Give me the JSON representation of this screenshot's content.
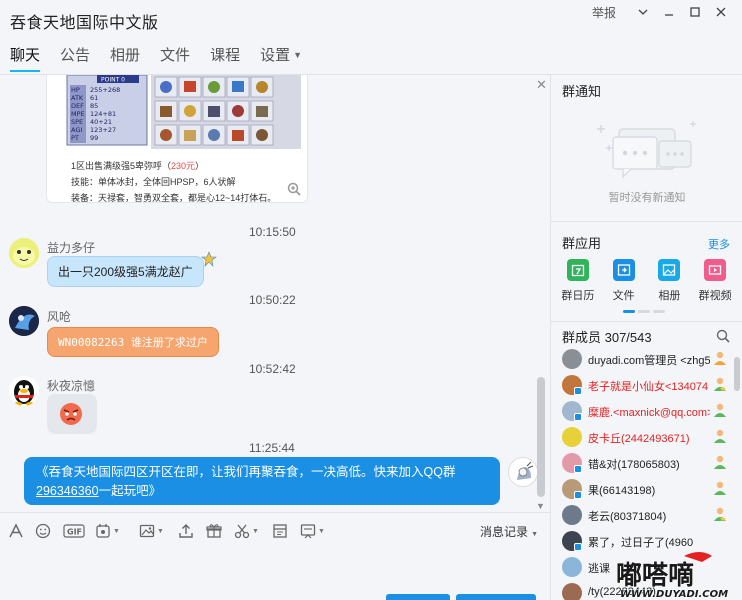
{
  "window": {
    "title": "吞食天地国际中文版",
    "report_label": "举报"
  },
  "tabs": [
    {
      "label": "聊天",
      "active": true
    },
    {
      "label": "公告"
    },
    {
      "label": "相册"
    },
    {
      "label": "文件"
    },
    {
      "label": "课程"
    },
    {
      "label": "设置"
    }
  ],
  "chat": {
    "card": {
      "stat_title": "POINT 0",
      "stats": [
        "255+268",
        "61",
        "85",
        "124+81",
        "40+21",
        "123+27",
        "99"
      ],
      "stat_labels": [
        "HP",
        "ATK",
        "DEF",
        "MPE",
        "SPE",
        "AGI",
        "PT"
      ],
      "line1": "1区出售满级强5卑弥呼（",
      "price": "230元",
      "line1_end": "）",
      "line2": "技能：单体冰封，全体回HPSP，6人状解",
      "line3": "装备：天禄套，智勇双全套，都是心12~14打体石。"
    },
    "messages": [
      {
        "time": "10:15:50",
        "nick": "益力多仔",
        "text": "出一只200级强5满龙赵广",
        "style": "blue"
      },
      {
        "time": "10:50:22",
        "nick": "风呛",
        "text": "WN00082263 谁注册了求过户",
        "style": "orange"
      },
      {
        "time": "10:52:42",
        "nick": "秋夜凉憶",
        "text": "",
        "style": "sticker"
      },
      {
        "time": "11:25:44",
        "self": true,
        "text_before": "《吞食天地国际四区开区在即，让我们再聚吞食，一决高低。快来加入QQ群",
        "group_number": "296346360",
        "text_after": "一起玩吧》"
      }
    ]
  },
  "toolbar": {
    "history_label": "消息记录"
  },
  "right": {
    "notice_title": "群通知",
    "notice_empty": "暂时没有新通知",
    "apps_title": "群应用",
    "apps_more": "更多",
    "apps": [
      {
        "label": "群日历",
        "color": "#2fb45a"
      },
      {
        "label": "文件",
        "color": "#1a8fe3"
      },
      {
        "label": "相册",
        "color": "#19a8e8"
      },
      {
        "label": "群视频",
        "color": "#f05d8c"
      }
    ],
    "members_title": "群成员 307/543",
    "members": [
      {
        "name": "duyadi.com管理员 <zhg5",
        "red": false,
        "avatar": "#8a8f96",
        "role": "owner"
      },
      {
        "name": "老子就是小仙女<134074",
        "red": true,
        "avatar": "#c0763c",
        "role": "admin"
      },
      {
        "name": "糜鹿.<maxnick@qq.com>",
        "red": true,
        "avatar": "#a0b7cf",
        "role": "member"
      },
      {
        "name": "皮卡丘(2442493671)",
        "red": true,
        "avatar": "#e7d13a",
        "role": "member"
      },
      {
        "name": "错&对(178065803)",
        "red": false,
        "avatar": "#e39aa8",
        "role": "member"
      },
      {
        "name": "果(66143198)",
        "red": false,
        "avatar": "#b89a76",
        "role": "member"
      },
      {
        "name": "老云(80371804)",
        "red": false,
        "avatar": "#6c7a8a",
        "role": "admin"
      },
      {
        "name": "累了，过日子了(4960",
        "red": false,
        "avatar": "#3d4450",
        "role": "member"
      },
      {
        "name": "逃课",
        "red": false,
        "avatar": "#8cb6d9",
        "role": "member"
      },
      {
        "name": "/ty(22283443)",
        "red": false,
        "avatar": "#9a6b52",
        "role": "member"
      }
    ]
  },
  "watermark": {
    "text": "嘟嗒嘀",
    "url": "WWW.DUYADI.COM"
  },
  "colors": {
    "accent": "#12b7f5",
    "self_bubble": "#1a8fe3",
    "orange_bubble": "#f7a56e",
    "red_name": "#e52222"
  }
}
